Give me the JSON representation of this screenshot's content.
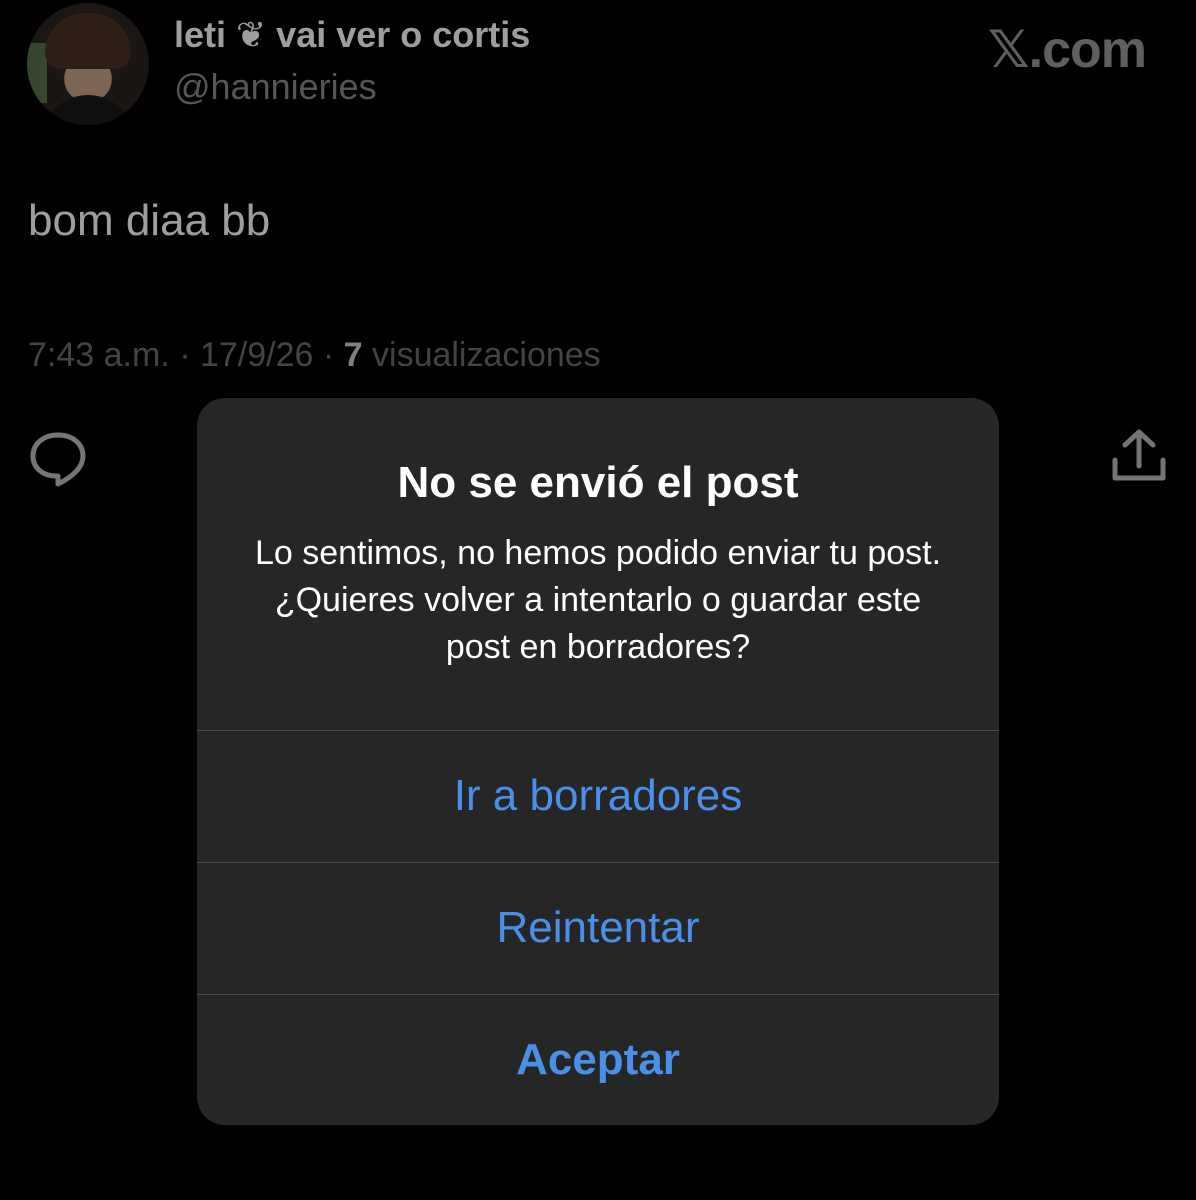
{
  "tweet": {
    "display_name": "leti ❦ vai ver o cortis",
    "handle": "@hannieries",
    "brand": "𝕏.com",
    "text": "bom diaa bb",
    "time": "7:43 a.m.",
    "separator": " · ",
    "date": "17/9/26",
    "views_count": "7",
    "views_label": " visualizaciones",
    "icons": {
      "reply": "reply-bubble-icon",
      "share": "share-upload-icon"
    }
  },
  "alert": {
    "title": "No se envió el post",
    "message": "Lo sentimos, no hemos podido enviar tu post. ¿Quieres volver a intentarlo o guardar este post en borradores?",
    "buttons": {
      "drafts": "Ir a borradores",
      "retry": "Reintentar",
      "accept": "Aceptar"
    }
  },
  "colors": {
    "background": "#000000",
    "alert_background": "#262626",
    "button_blue": "#4a90e8",
    "secondary_text": "#8b8b8b"
  }
}
